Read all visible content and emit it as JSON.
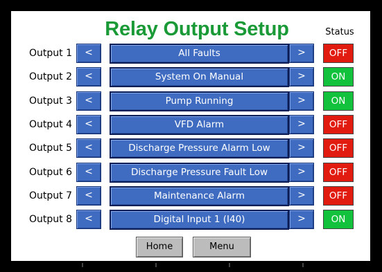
{
  "header": {
    "title": "Relay Output Setup",
    "status_label": "Status"
  },
  "nav": {
    "prev_symbol": "<",
    "next_symbol": ">"
  },
  "outputs": [
    {
      "label": "Output 1",
      "function": "All Faults",
      "status": "OFF"
    },
    {
      "label": "Output 2",
      "function": "System On Manual",
      "status": "ON"
    },
    {
      "label": "Output 3",
      "function": "Pump Running",
      "status": "ON"
    },
    {
      "label": "Output 4",
      "function": "VFD Alarm",
      "status": "OFF"
    },
    {
      "label": "Output 5",
      "function": "Discharge Pressure Alarm Low",
      "status": "OFF"
    },
    {
      "label": "Output 6",
      "function": "Discharge Pressure Fault Low",
      "status": "OFF"
    },
    {
      "label": "Output 7",
      "function": "Maintenance Alarm",
      "status": "OFF"
    },
    {
      "label": "Output 8",
      "function": "Digital Input 1 (I40)",
      "status": "ON"
    }
  ],
  "footer": {
    "home_label": "Home",
    "menu_label": "Menu"
  },
  "colors": {
    "title": "#1a9a36",
    "on": "#12c23c",
    "off": "#e21b10",
    "selector": "#3f6cc1"
  }
}
